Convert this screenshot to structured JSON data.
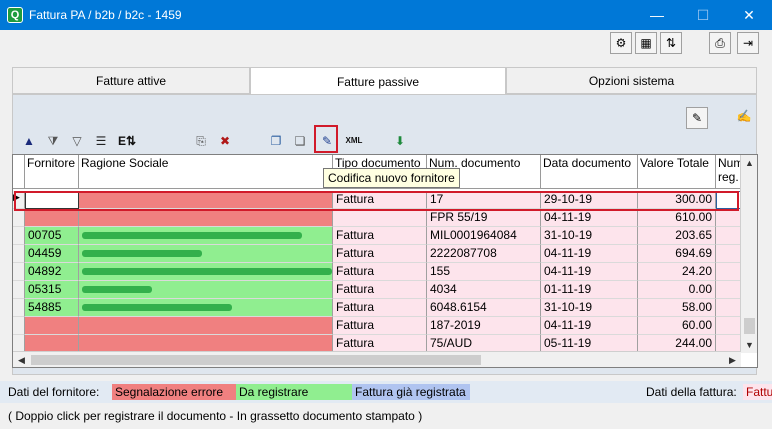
{
  "window": {
    "title": "Fattura PA / b2b / b2c - 1459",
    "app_icon": "Q",
    "minimize": "—",
    "maximize": "☐",
    "close": "✕"
  },
  "top_toolbar": [
    {
      "name": "refresh-settings-icon",
      "glyph": "⚙"
    },
    {
      "name": "archive-icon",
      "glyph": "▦"
    },
    {
      "name": "sync-icon",
      "glyph": "⇅"
    },
    {
      "name": "print-icon",
      "glyph": "⎙"
    },
    {
      "name": "exit-icon",
      "glyph": "⇥"
    }
  ],
  "tabs": [
    {
      "label": "Fatture attive",
      "active": false
    },
    {
      "label": "Fatture passive",
      "active": true
    },
    {
      "label": "Opzioni sistema",
      "active": false
    }
  ],
  "panel_actions": [
    {
      "name": "notes-icon",
      "glyph": "✎"
    },
    {
      "name": "disable-signature-icon",
      "glyph": "✍"
    }
  ],
  "grid_toolbar": [
    {
      "name": "sort-up-icon",
      "glyph": "▲"
    },
    {
      "name": "filter-edit-icon",
      "glyph": "⧩"
    },
    {
      "name": "filter-icon",
      "glyph": "▽"
    },
    {
      "name": "list-icon",
      "glyph": "☰"
    },
    {
      "name": "export-icon",
      "glyph": "E⇅"
    },
    {
      "name": "document-search-icon",
      "glyph": "⎘"
    },
    {
      "name": "delete-icon",
      "glyph": "✖"
    },
    {
      "name": "copy-icon",
      "glyph": "❐"
    },
    {
      "name": "paste-icon",
      "glyph": "❏"
    },
    {
      "name": "new-supplier-icon",
      "glyph": "✎"
    },
    {
      "name": "xml-icon",
      "glyph": "XML"
    },
    {
      "name": "import-icon",
      "glyph": "⬇"
    }
  ],
  "tooltip": "Codifica nuovo fornitore",
  "columns": [
    "Fornitore",
    "Ragione Sociale",
    "Tipo documento",
    "Num. documento",
    "Data documento",
    "Valore Totale",
    "Num. reg."
  ],
  "rows": [
    {
      "fornitore": "",
      "ragione": "",
      "tipo": "Fattura",
      "num": "17",
      "data": "29-10-19",
      "totale": "300.00",
      "status": "error",
      "selected": true
    },
    {
      "fornitore": "",
      "ragione": "",
      "tipo": "",
      "num": "FPR 55/19",
      "data": "04-11-19",
      "totale": "610.00",
      "status": "error",
      "selected": false
    },
    {
      "fornitore": "00705",
      "ragione": "",
      "tipo": "Fattura",
      "num": "MIL0001964084",
      "data": "31-10-19",
      "totale": "203.65",
      "status": "to_register",
      "selected": false
    },
    {
      "fornitore": "04459",
      "ragione": "",
      "tipo": "Fattura",
      "num": "2222087708",
      "data": "04-11-19",
      "totale": "694.69",
      "status": "to_register",
      "selected": false
    },
    {
      "fornitore": "04892",
      "ragione": "",
      "tipo": "Fattura",
      "num": "155",
      "data": "04-11-19",
      "totale": "24.20",
      "status": "to_register",
      "selected": false
    },
    {
      "fornitore": "05315",
      "ragione": "",
      "tipo": "Fattura",
      "num": "4034",
      "data": "01-11-19",
      "totale": "0.00",
      "status": "to_register",
      "selected": false
    },
    {
      "fornitore": "54885",
      "ragione": "",
      "tipo": "Fattura",
      "num": "6048.6154",
      "data": "31-10-19",
      "totale": "58.00",
      "status": "to_register",
      "selected": false
    },
    {
      "fornitore": "",
      "ragione": "",
      "tipo": "Fattura",
      "num": "187-2019",
      "data": "04-11-19",
      "totale": "60.00",
      "status": "error",
      "selected": false
    },
    {
      "fornitore": "",
      "ragione": "",
      "tipo": "Fattura",
      "num": "75/AUD",
      "data": "05-11-19",
      "totale": "244.00",
      "status": "error",
      "selected": false
    }
  ],
  "legend": {
    "supplier_label": "Dati del fornitore:",
    "error": "Segnalazione errore",
    "to_register": "Da registrare",
    "registered": "Fattura già registrata",
    "invoice_label": "Dati della fattura:",
    "invoice_tail": "Fattu"
  },
  "footer_note": "( Doppio click per registrare il documento - In grassetto documento stampato )",
  "colors": {
    "titlebar": "#0078d7",
    "error": "#f08080",
    "to_register": "#90ee90",
    "registered": "#b0c4f0",
    "pink": "#fde4ec",
    "highlight": "#d11a2a"
  }
}
